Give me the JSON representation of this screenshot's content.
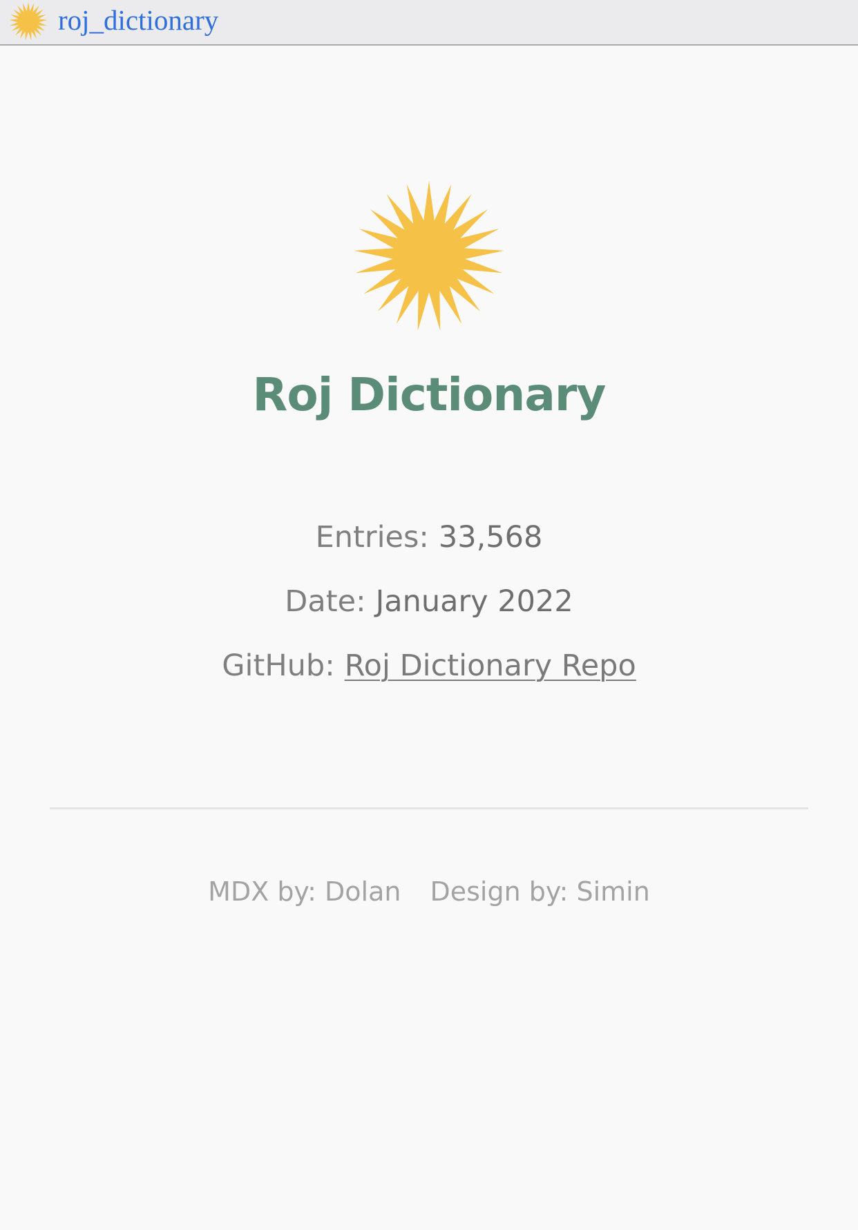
{
  "window": {
    "title": "roj_dictionary",
    "icon": "sun-icon"
  },
  "logo": {
    "icon": "sun-icon",
    "color": "#f5c146"
  },
  "title": "Roj Dictionary",
  "title_color": "#5a8c77",
  "info": {
    "entries_label": "Entries:",
    "entries_value": "33,568",
    "date_label": "Date:",
    "date_value": "January 2022",
    "github_label": "GitHub:",
    "github_link_text": "Roj Dictionary Repo"
  },
  "credits": {
    "mdx": "MDX by: Dolan",
    "design": "Design by: Simin"
  }
}
